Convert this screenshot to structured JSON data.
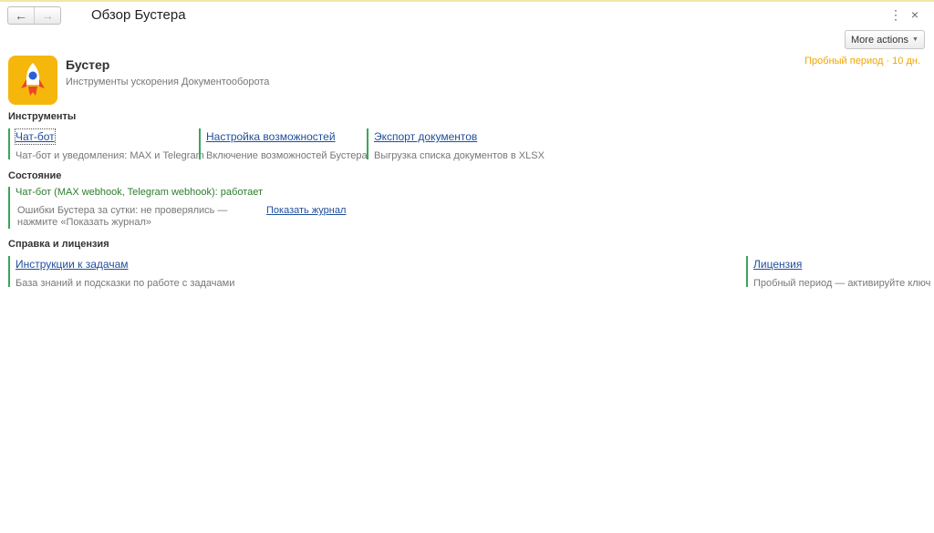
{
  "window": {
    "title": "Обзор Бустера",
    "back_icon": "arrow-left-icon",
    "forward_icon": "arrow-right-icon",
    "back_glyph": "←",
    "forward_glyph": "→",
    "more_glyph": "⋮",
    "close_glyph": "×"
  },
  "toolbar": {
    "more_actions_label": "More actions",
    "caret": "▼"
  },
  "app": {
    "name": "Бустер",
    "description": "Инструменты ускорения Документооборота",
    "trial": "Пробный период · 10 дн.",
    "logo_icon": "rocket-icon",
    "accent_color": "#f5b70b"
  },
  "sections": {
    "tools": {
      "title": "Инструменты",
      "cards": [
        {
          "label": "Чат-бот",
          "description": "Чат-бот и уведомления: MAX и Telegram"
        },
        {
          "label": "Настройка возможностей",
          "description": "Включение возможностей Бустера"
        },
        {
          "label": "Экспорт документов",
          "description": "Выгрузка списка документов в XLSX"
        }
      ]
    },
    "status": {
      "title": "Состояние",
      "chatbot_status": "Чат-бот (MAX webhook, Telegram webhook): работает",
      "errors_text": "Ошибки Бустера за сутки: не проверялись — нажмите «Показать журнал»",
      "journal_link": "Показать журнал"
    },
    "help": {
      "title": "Справка и лицензия",
      "cards": [
        {
          "label": "Инструкции к задачам",
          "description": "База знаний и подсказки по работе с задачами"
        },
        {
          "label": "Лицензия",
          "description": "Пробный период — активируйте ключ"
        }
      ]
    }
  },
  "colors": {
    "link": "#1f4e9c",
    "card_border": "#3ba55d",
    "status_ok": "#2d7d2d",
    "trial": "#f0a500"
  }
}
